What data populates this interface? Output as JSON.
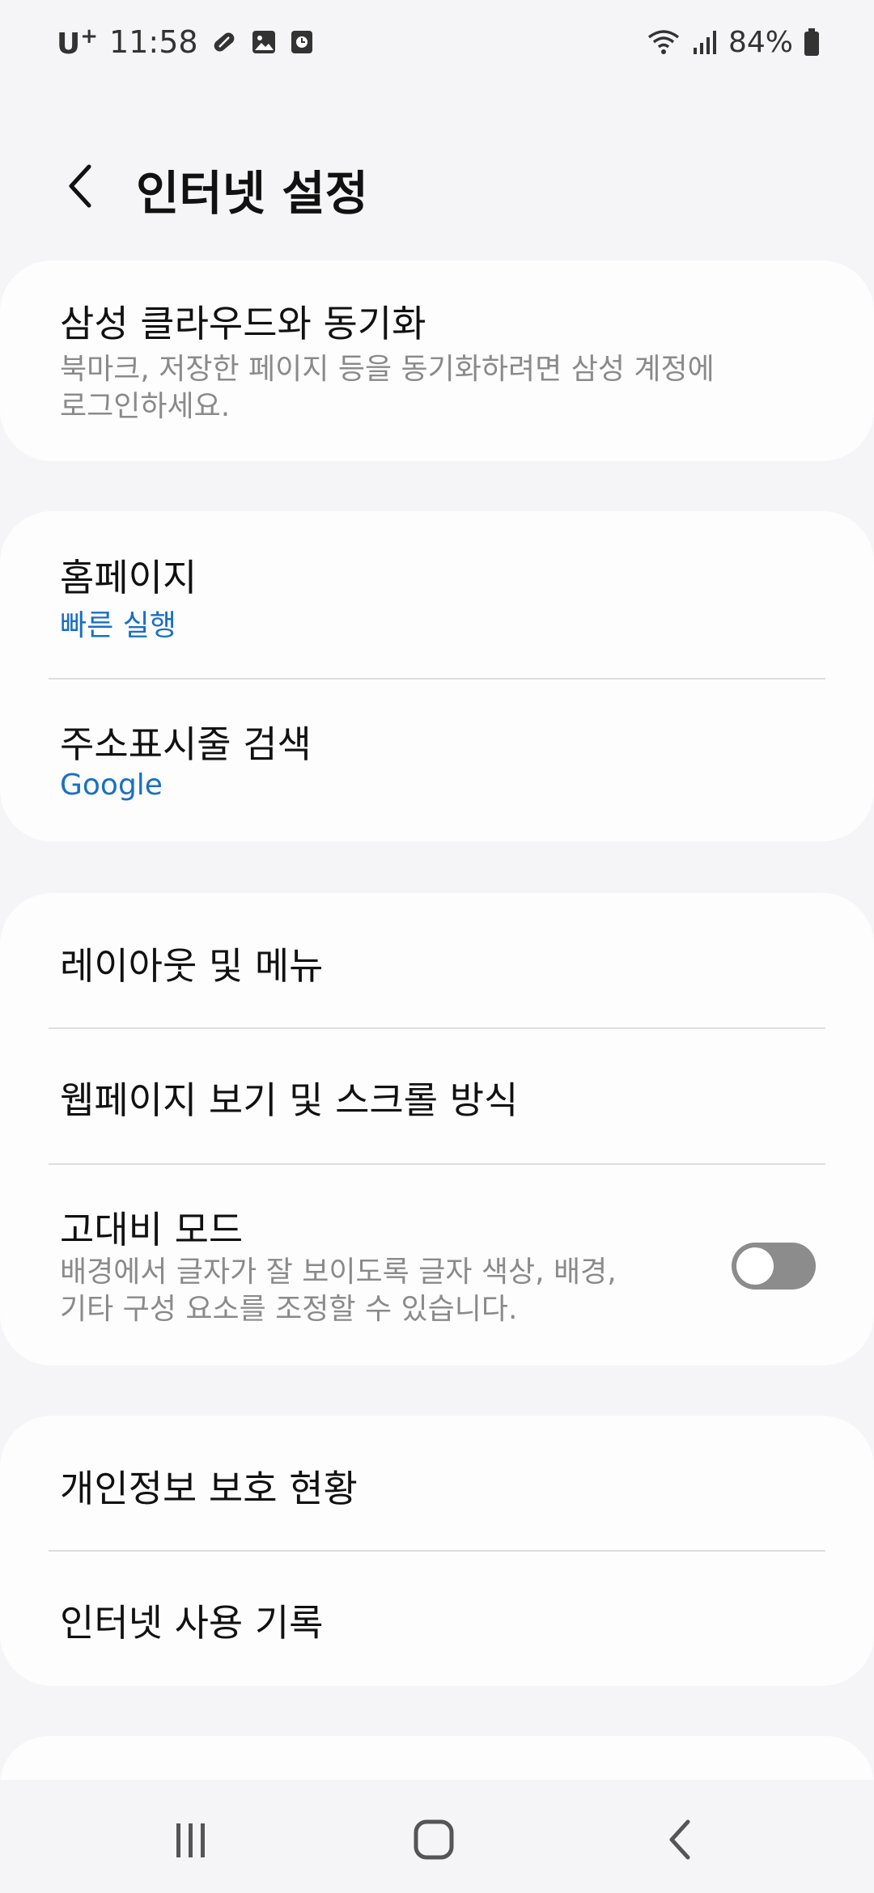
{
  "status": {
    "carrier": "U",
    "carrier_sup": "+",
    "time": "11:58",
    "battery": "84%"
  },
  "header": {
    "title": "인터넷 설정"
  },
  "sections": {
    "sync": {
      "title": "삼성 클라우드와 동기화",
      "desc_line1": "북마크, 저장한 페이지 등을 동기화하려면 삼성 계정에",
      "desc_line2": "로그인하세요."
    },
    "homepage": {
      "title": "홈페이지",
      "value": "빠른 실행"
    },
    "search": {
      "title": "주소표시줄 검색",
      "value": "Google"
    },
    "layout": {
      "title": "레이아웃 및 메뉴"
    },
    "webview": {
      "title": "웹페이지 보기 및 스크롤 방식"
    },
    "contrast": {
      "title": "고대비 모드",
      "desc_line1": "배경에서 글자가 잘 보이도록 글자 색상, 배경,",
      "desc_line2": "기타 구성 요소를 조정할 수 있습니다.",
      "toggle_on": false
    },
    "privacy": {
      "title": "개인정보 보호 현황"
    },
    "history": {
      "title": "인터넷 사용 기록"
    }
  },
  "icons": {
    "back": "chevron-left-icon",
    "recents": "recents-icon",
    "home": "home-icon",
    "nav_back": "nav-back-icon"
  },
  "colors": {
    "accent": "#1a6fc4",
    "toggle_off": "#8c8c8c"
  }
}
